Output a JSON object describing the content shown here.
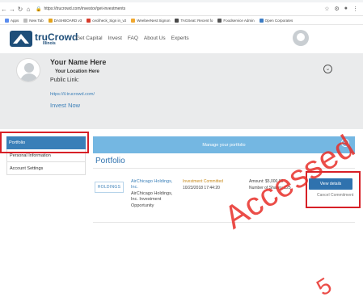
{
  "browser": {
    "url": "https://trucrowd.com/investor/get-investments",
    "bookmarks": [
      {
        "label": "Apps",
        "color": "#5b8def"
      },
      {
        "label": "New Tab",
        "color": "#bbbbbb"
      },
      {
        "label": "DASHBOARD v3",
        "color": "#e3a21a"
      },
      {
        "label": "cecilheck_Sign in_v2",
        "color": "#d73b2b"
      },
      {
        "label": "WeebeeNest Signon",
        "color": "#f0a830"
      },
      {
        "label": "TAGSeat: Recent fo",
        "color": "#4a4a4a"
      },
      {
        "label": "Foodservice Admin",
        "color": "#555555"
      },
      {
        "label": "Open Corporates",
        "color": "#3c7cc4"
      }
    ]
  },
  "site": {
    "brand": "truCrowd",
    "region": "Illinois",
    "nav": [
      "Get Capital",
      "Invest",
      "FAQ",
      "About Us",
      "Experts"
    ]
  },
  "profile": {
    "name": "Your Name Here",
    "location": "Your Location Here",
    "public_link_label": "Public Link:",
    "public_link_url": "https://il.trucrowd.com/",
    "invest_now": "Invest Now"
  },
  "sidebar": {
    "items": [
      {
        "label": "Portfolio",
        "active": true
      },
      {
        "label": "Personal Information",
        "active": false
      },
      {
        "label": "Account Settings",
        "active": false
      }
    ]
  },
  "main": {
    "manage_bar": "Manage your portfolio",
    "title": "Portfolio",
    "investment": {
      "logo_text": "HOLDINGS",
      "company_link": "AirChicago Holdings, Inc.",
      "company_desc": "AirChicago Holdings, Inc. Investment Opportunity",
      "status": "Investment Committed",
      "date": "10/23/2018 17:44:20",
      "amount": "Amount: $5,000.00",
      "shares": "Number of Shares: 125",
      "view_details": "View details",
      "cancel": "Cancel Commitment"
    }
  },
  "watermark": {
    "text1": "Accessed",
    "text2": "5"
  },
  "colors": {
    "accent": "#3a7fb8",
    "bar": "#74b7e2",
    "highlight": "#d72027",
    "status": "#c88a1a",
    "banner": "#eaebec"
  }
}
